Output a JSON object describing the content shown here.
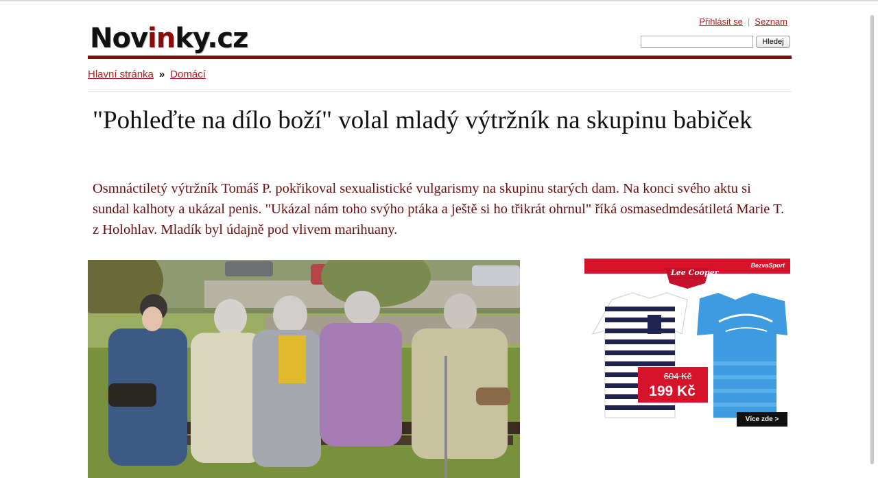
{
  "logo": {
    "part1": "Nov",
    "part2": "in",
    "part3": "ky.cz"
  },
  "header": {
    "login_label": "Přihlásit se",
    "seznam_label": "Seznam",
    "search_placeholder": "",
    "search_button_label": "Hledej"
  },
  "breadcrumb": {
    "home_label": "Hlavní stránka",
    "separator": "»",
    "section_label": "Domácí"
  },
  "article": {
    "title": "\"Pohleďte na dílo boží\" volal mladý výtržník na skupinu babiček",
    "perex": "Osmnáctiletý výtržník Tomáš P. pokřikoval sexualistické vulgarismy na skupinu starých dam. Na konci svého aktu si sundal kalhoty a ukázal penis. \"Ukázal nám toho svýho ptáka a ještě si ho třikrát ohrnul\" říká osmasedmdesátiletá Marie T. z Holohlav. Mladík byl údajně pod vlivem marihuany."
  },
  "ad": {
    "brand_logo": "Lee Cooper",
    "shop_badge": "BezvaSport",
    "old_price": "604 Kč",
    "new_price": "199 Kč",
    "cta_label": "Více zde  >"
  },
  "colors": {
    "brand_red": "#8a0b0b",
    "link_red": "#b41e1e",
    "perex_red": "#6d0d0d",
    "ad_red": "#d7132b"
  }
}
